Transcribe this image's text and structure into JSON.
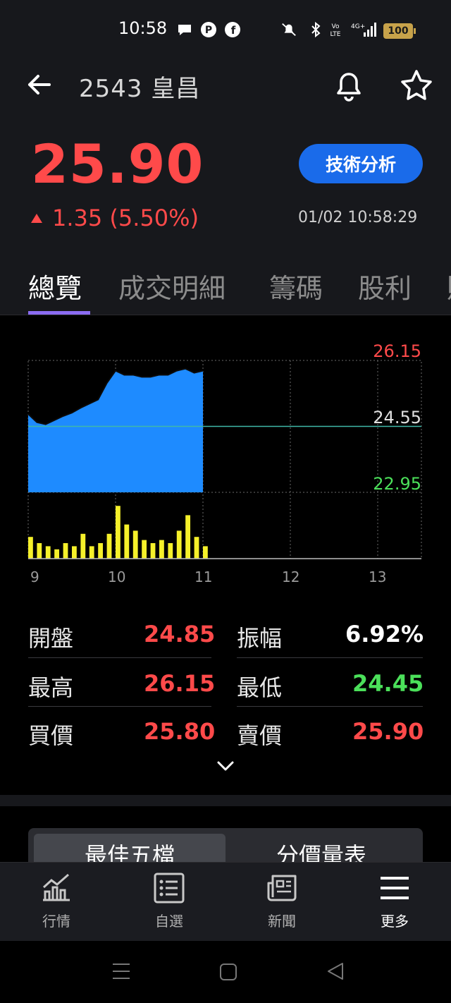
{
  "status_bar": {
    "time": "10:58",
    "battery": "100",
    "network": "4G+"
  },
  "header": {
    "stock_code": "2543",
    "stock_name": "皇昌",
    "price": "25.90",
    "change": "1.35 (5.50%)",
    "timestamp": "01/02 10:58:29",
    "tech_button": "技術分析"
  },
  "tabs": [
    "總覽",
    "成交明細",
    "籌碼",
    "股利",
    "財"
  ],
  "chart_data": {
    "type": "area",
    "y_ticks": [
      "26.15",
      "24.55",
      "22.95"
    ],
    "ylim": [
      22.95,
      26.15
    ],
    "reference_price": 24.55,
    "x_ticks": [
      "9",
      "10",
      "11",
      "12",
      "13"
    ],
    "x": [
      9.0,
      9.1,
      9.2,
      9.3,
      9.4,
      9.5,
      9.6,
      9.7,
      9.8,
      9.9,
      10.0,
      10.1,
      10.2,
      10.3,
      10.4,
      10.5,
      10.6,
      10.7,
      10.8,
      10.9,
      11.0
    ],
    "price": [
      24.85,
      24.65,
      24.6,
      24.7,
      24.8,
      24.88,
      25.0,
      25.1,
      25.2,
      25.6,
      25.9,
      25.8,
      25.8,
      25.75,
      25.75,
      25.8,
      25.8,
      25.9,
      25.95,
      25.85,
      25.9
    ],
    "volume": [
      0.35,
      0.25,
      0.2,
      0.15,
      0.25,
      0.2,
      0.4,
      0.2,
      0.25,
      0.4,
      0.85,
      0.55,
      0.45,
      0.3,
      0.25,
      0.3,
      0.25,
      0.45,
      0.7,
      0.35,
      0.2
    ],
    "colors": {
      "area": "#1e8bff",
      "volume": "#f5f02a",
      "ref_line": "#3fb8a8",
      "high": "#ff4a4a",
      "low": "#4be05a"
    }
  },
  "stats": {
    "open_label": "開盤",
    "open_value": "24.85",
    "amp_label": "振幅",
    "amp_value": "6.92%",
    "high_label": "最高",
    "high_value": "26.15",
    "low_label": "最低",
    "low_value": "24.45",
    "bid_label": "買價",
    "bid_value": "25.80",
    "ask_label": "賣價",
    "ask_value": "25.90"
  },
  "sub_tabs": [
    "最佳五檔",
    "分價量表"
  ],
  "bottom_nav": [
    "行情",
    "自選",
    "新聞",
    "更多"
  ],
  "colors": {
    "up": "#ff4a4a",
    "down": "#4be05a",
    "accent": "#1a6bea",
    "tab_indicator": "#8b6cf2"
  }
}
